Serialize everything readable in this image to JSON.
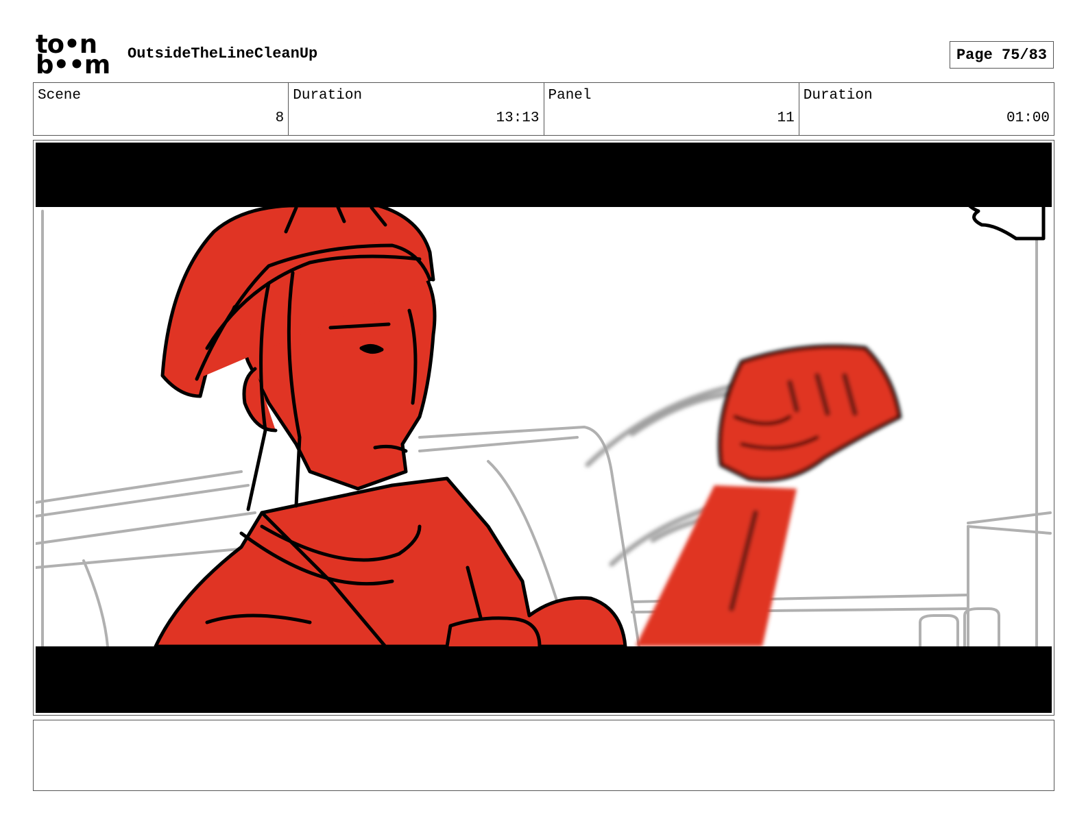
{
  "header": {
    "logo_line1": "to•n",
    "logo_line2": "b••m",
    "project_title": "OutsideTheLineCleanUp",
    "page_indicator": "Page 75/83"
  },
  "info": {
    "scene_label": "Scene",
    "scene_value": "8",
    "scene_duration_label": "Duration",
    "scene_duration_value": "13:13",
    "panel_label": "Panel",
    "panel_value": "11",
    "panel_duration_label": "Duration",
    "panel_duration_value": "01:00"
  },
  "colors": {
    "character_fill": "#e03424",
    "letterbox": "#000000",
    "background_sketch": "#b0b0b0"
  },
  "notes": {
    "text": ""
  }
}
